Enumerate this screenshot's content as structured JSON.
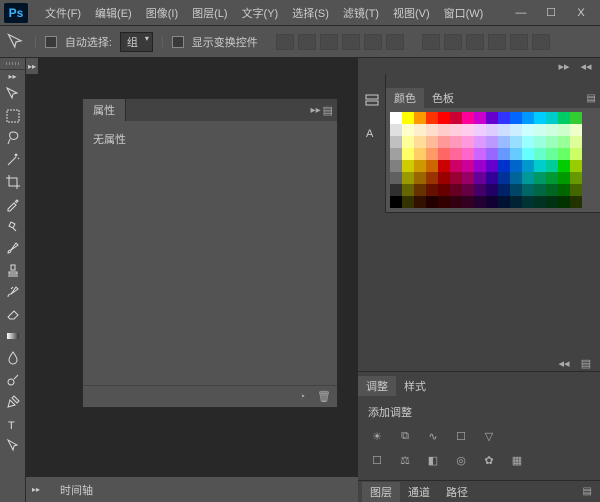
{
  "app": {
    "logo_text": "Ps"
  },
  "menu": {
    "items": [
      {
        "label": "文件(F)"
      },
      {
        "label": "编辑(E)"
      },
      {
        "label": "图像(I)"
      },
      {
        "label": "图层(L)"
      },
      {
        "label": "文字(Y)"
      },
      {
        "label": "选择(S)"
      },
      {
        "label": "滤镜(T)"
      },
      {
        "label": "视图(V)"
      },
      {
        "label": "窗口(W)"
      }
    ]
  },
  "window_controls": {
    "min": "—",
    "max": "☐",
    "close": "X"
  },
  "optionbar": {
    "auto_select_label": "自动选择:",
    "dropdown_value": "组",
    "show_transform_label": "显示变换控件"
  },
  "panels": {
    "properties": {
      "tab_label": "属性",
      "body_text": "无属性"
    },
    "timeline": {
      "tab_label": "时间轴"
    },
    "color": {
      "tab1": "颜色",
      "tab2": "色板",
      "swatches": [
        "#ffffff",
        "#ffff00",
        "#ff9900",
        "#ff3300",
        "#ff0000",
        "#cc0033",
        "#ff0099",
        "#cc00cc",
        "#6600cc",
        "#3333ff",
        "#0066ff",
        "#0099ff",
        "#00ccff",
        "#00cccc",
        "#00cc66",
        "#33cc33",
        "#e0e0e0",
        "#ffffcc",
        "#ffeecc",
        "#ffddcc",
        "#ffcccc",
        "#ffccdd",
        "#ffccee",
        "#eeccff",
        "#ddccff",
        "#ccddff",
        "#cceeff",
        "#ccffff",
        "#ccffee",
        "#ccffdd",
        "#ccffcc",
        "#eeffcc",
        "#c0c0c0",
        "#ffff99",
        "#ffdd99",
        "#ffbb99",
        "#ff9999",
        "#ff99bb",
        "#ff99dd",
        "#dd99ff",
        "#bb99ff",
        "#99bbff",
        "#99ddff",
        "#99ffff",
        "#99ffdd",
        "#99ffbb",
        "#99ff99",
        "#ddff99",
        "#a0a0a0",
        "#ffff66",
        "#ffcc66",
        "#ff9966",
        "#ff6666",
        "#ff6699",
        "#ff66cc",
        "#cc66ff",
        "#9966ff",
        "#6699ff",
        "#66ccff",
        "#66ffff",
        "#66ffcc",
        "#66ff99",
        "#66ff66",
        "#ccff66",
        "#808080",
        "#cccc00",
        "#cc9900",
        "#cc6600",
        "#cc0000",
        "#cc0066",
        "#cc0099",
        "#9900cc",
        "#6600cc",
        "#0033cc",
        "#0066cc",
        "#0099cc",
        "#00cccc",
        "#00cc99",
        "#00cc00",
        "#99cc00",
        "#606060",
        "#999900",
        "#996600",
        "#993300",
        "#990000",
        "#990033",
        "#990066",
        "#660099",
        "#330099",
        "#003399",
        "#006699",
        "#009999",
        "#009966",
        "#009933",
        "#009900",
        "#669900",
        "#303030",
        "#666600",
        "#663300",
        "#661100",
        "#660000",
        "#660022",
        "#660044",
        "#440066",
        "#220066",
        "#002266",
        "#004466",
        "#006666",
        "#006644",
        "#006622",
        "#006600",
        "#446600",
        "#000000",
        "#333300",
        "#331100",
        "#220000",
        "#330000",
        "#330011",
        "#330022",
        "#220033",
        "#110033",
        "#001133",
        "#002233",
        "#003333",
        "#003322",
        "#003311",
        "#003300",
        "#223300"
      ]
    },
    "adjustments": {
      "tab1": "调整",
      "tab2": "样式",
      "title": "添加调整"
    },
    "bottom": {
      "tab1": "图层",
      "tab2": "通道",
      "tab3": "路径"
    }
  }
}
